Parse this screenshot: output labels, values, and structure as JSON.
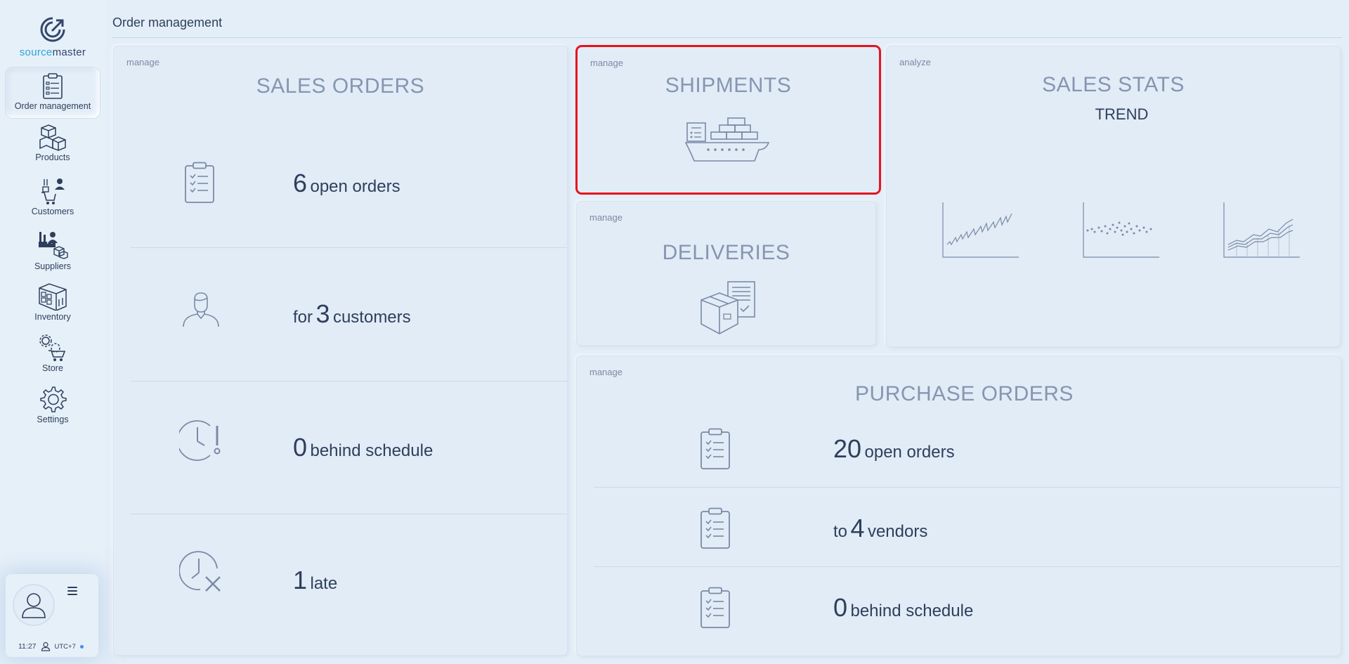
{
  "brand": {
    "part1": "source",
    "part2": "master"
  },
  "sidebar": {
    "items": [
      {
        "label": "Order management",
        "icon": "clipboard-icon",
        "active": true
      },
      {
        "label": "Products",
        "icon": "boxes-icon"
      },
      {
        "label": "Customers",
        "icon": "customer-icon"
      },
      {
        "label": "Suppliers",
        "icon": "factory-icon"
      },
      {
        "label": "Inventory",
        "icon": "warehouse-icon"
      },
      {
        "label": "Store",
        "icon": "store-cart-icon"
      },
      {
        "label": "Settings",
        "icon": "gear-icon"
      }
    ]
  },
  "user": {
    "time": "11:27",
    "timezone": "UTC+7",
    "status_color": "#4a8de8"
  },
  "header": {
    "title": "Order management"
  },
  "sales_orders": {
    "tag": "manage",
    "title": "SALES ORDERS",
    "rows": [
      {
        "pre": "",
        "num": "6",
        "post": "open orders",
        "icon": "clipboard-icon"
      },
      {
        "pre": "for",
        "num": "3",
        "post": "customers",
        "icon": "person-icon"
      },
      {
        "pre": "",
        "num": "0",
        "post": "behind schedule",
        "icon": "clock-alert-icon"
      },
      {
        "pre": "",
        "num": "1",
        "post": "late",
        "icon": "clock-cancel-icon"
      }
    ]
  },
  "shipments": {
    "tag": "manage",
    "title": "SHIPMENTS",
    "icon": "ship-icon",
    "highlight_color": "#e5131d"
  },
  "deliveries": {
    "tag": "manage",
    "title": "DELIVERIES",
    "icon": "package-icon"
  },
  "sales_stats": {
    "tag": "analyze",
    "title": "SALES STATS",
    "subtitle": "TREND",
    "icons": [
      "line-chart-icon",
      "scatter-chart-icon",
      "area-chart-icon"
    ]
  },
  "purchase_orders": {
    "tag": "manage",
    "title": "PURCHASE ORDERS",
    "rows": [
      {
        "pre": "",
        "num": "20",
        "post": "open orders",
        "icon": "clipboard-icon"
      },
      {
        "pre": "to",
        "num": "4",
        "post": "vendors",
        "icon": "clipboard-icon"
      },
      {
        "pre": "",
        "num": "0",
        "post": "behind schedule",
        "icon": "clipboard-icon"
      }
    ]
  },
  "colors": {
    "background": "#e4eef8",
    "text": "#2e3f5c",
    "title_muted": "#8696b1",
    "icon_stroke": "#7a8aa6"
  }
}
